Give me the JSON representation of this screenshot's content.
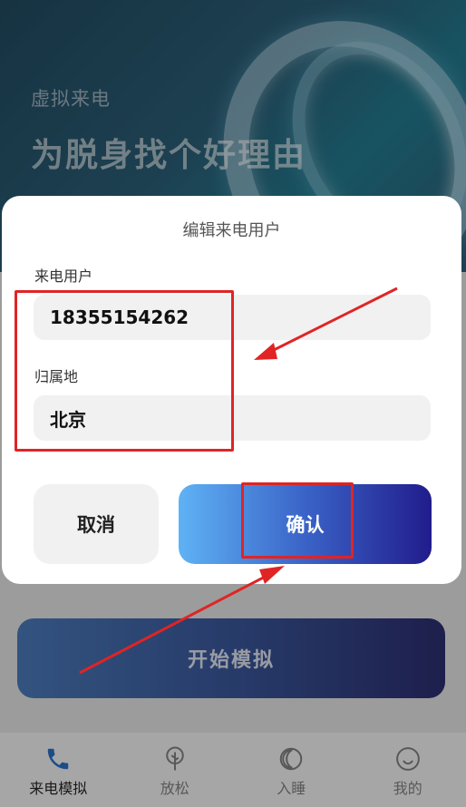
{
  "hero": {
    "subtitle": "虚拟来电",
    "title": "为脱身找个好理由"
  },
  "main": {
    "start_label": "开始模拟"
  },
  "tabbar": {
    "items": [
      {
        "label": "来电模拟",
        "icon": "phone-icon",
        "active": true
      },
      {
        "label": "放松",
        "icon": "tree-icon",
        "active": false
      },
      {
        "label": "入睡",
        "icon": "moon-icon",
        "active": false
      },
      {
        "label": "我的",
        "icon": "smile-icon",
        "active": false
      }
    ]
  },
  "dialog": {
    "title": "编辑来电用户",
    "caller_label": "来电用户",
    "caller_value": "18355154262",
    "location_label": "归属地",
    "location_value": "北京",
    "cancel_label": "取消",
    "confirm_label": "确认"
  },
  "colors": {
    "annotation": "#e02424",
    "confirm_gradient_start": "#5fb2f5",
    "confirm_gradient_end": "#211c8c"
  }
}
